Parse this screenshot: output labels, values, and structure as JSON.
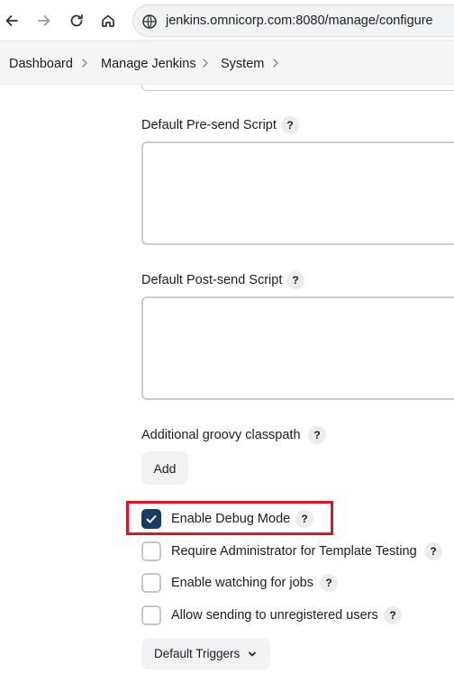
{
  "browser": {
    "url": "jenkins.omnicorp.com:8080/manage/configure"
  },
  "breadcrumb": {
    "items": [
      "Dashboard",
      "Manage Jenkins",
      "System"
    ]
  },
  "form": {
    "pre_send_label": "Default Pre-send Script",
    "pre_send_value": "",
    "post_send_label": "Default Post-send Script",
    "post_send_value": "",
    "classpath_label": "Additional groovy classpath",
    "add_label": "Add",
    "help_glyph": "?",
    "options": [
      {
        "label": "Enable Debug Mode",
        "checked": true
      },
      {
        "label": "Require Administrator for Template Testing",
        "checked": false
      },
      {
        "label": "Enable watching for jobs",
        "checked": false
      },
      {
        "label": "Allow sending to unregistered users",
        "checked": false
      }
    ],
    "triggers_label": "Default Triggers"
  },
  "colors": {
    "checkbox_checked": "#183d63",
    "highlight": "#e0141e"
  }
}
